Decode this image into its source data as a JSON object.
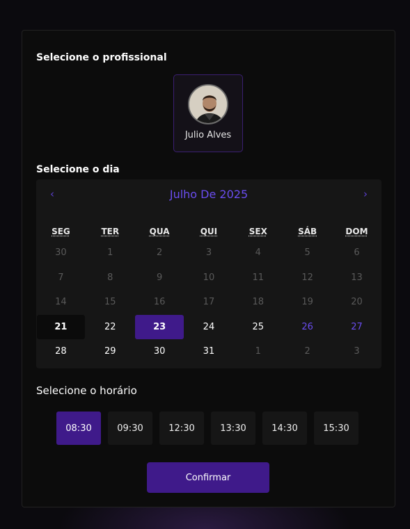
{
  "professional": {
    "section_title": "Selecione o profissional",
    "name": "Julio Alves"
  },
  "day": {
    "section_title": "Selecione o dia",
    "month_title": "Julho De 2025",
    "prev_icon": "‹",
    "next_icon": "›",
    "weekdays": [
      "SEG",
      "TER",
      "QUA",
      "QUI",
      "SEX",
      "SÁB",
      "DOM"
    ],
    "days": [
      {
        "d": "30",
        "s": "dim"
      },
      {
        "d": "1",
        "s": "dim"
      },
      {
        "d": "2",
        "s": "dim"
      },
      {
        "d": "3",
        "s": "dim"
      },
      {
        "d": "4",
        "s": "dim"
      },
      {
        "d": "5",
        "s": "dim"
      },
      {
        "d": "6",
        "s": "dim"
      },
      {
        "d": "7",
        "s": "dim"
      },
      {
        "d": "8",
        "s": "dim"
      },
      {
        "d": "9",
        "s": "dim"
      },
      {
        "d": "10",
        "s": "dim"
      },
      {
        "d": "11",
        "s": "dim"
      },
      {
        "d": "12",
        "s": "dim"
      },
      {
        "d": "13",
        "s": "dim"
      },
      {
        "d": "14",
        "s": "dim"
      },
      {
        "d": "15",
        "s": "dim"
      },
      {
        "d": "16",
        "s": "dim"
      },
      {
        "d": "17",
        "s": "dim"
      },
      {
        "d": "18",
        "s": "dim"
      },
      {
        "d": "19",
        "s": "dim"
      },
      {
        "d": "20",
        "s": "dim"
      },
      {
        "d": "21",
        "s": "today"
      },
      {
        "d": "22",
        "s": "act"
      },
      {
        "d": "23",
        "s": "sel"
      },
      {
        "d": "24",
        "s": "act"
      },
      {
        "d": "25",
        "s": "act"
      },
      {
        "d": "26",
        "s": "wknd"
      },
      {
        "d": "27",
        "s": "wknd"
      },
      {
        "d": "28",
        "s": "act"
      },
      {
        "d": "29",
        "s": "act"
      },
      {
        "d": "30",
        "s": "act"
      },
      {
        "d": "31",
        "s": "act"
      },
      {
        "d": "1",
        "s": "dim"
      },
      {
        "d": "2",
        "s": "dim"
      },
      {
        "d": "3",
        "s": "dim"
      }
    ]
  },
  "time": {
    "section_title": "Selecione o horário",
    "slots": [
      "08:30",
      "09:30",
      "12:30",
      "13:30",
      "14:30",
      "15:30"
    ],
    "selected_index": 0
  },
  "confirm_label": "Confirmar",
  "colors": {
    "accent": "#3f1a8a",
    "accent_text": "#6a4df0"
  }
}
